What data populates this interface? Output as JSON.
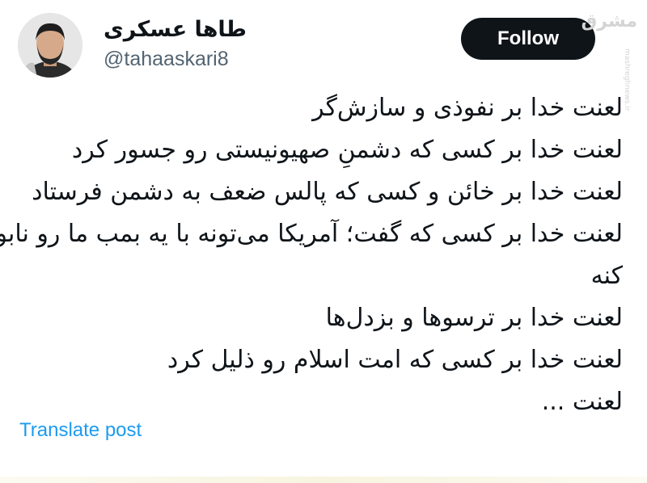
{
  "author": {
    "display_name": "طاها عسکری",
    "handle": "@tahaaskari8"
  },
  "actions": {
    "follow_label": "Follow",
    "translate_label": "Translate post"
  },
  "tweet": {
    "lines": [
      "لعنت خدا بر نفوذی و سازش‌گر",
      "لعنت خدا بر کسی که دشمنِ صهیونیستی رو جسور کرد",
      "لعنت خدا بر خائن و کسی که پالس ضعف به دشمن فرستاد",
      "لعنت خدا بر کسی که گفت؛ آمریکا می‌تونه با یه بمب ما رو نابود",
      "کنه",
      "لعنت خدا بر ترسوها و بزدل‌ها",
      "لعنت خدا بر کسی که امت اسلام رو ذلیل کرد",
      "لعنت ..."
    ]
  },
  "watermark": {
    "logo_text": "مشرق",
    "url": "mashreghnews.ir"
  },
  "colors": {
    "follow_bg": "#0f1419",
    "link": "#1d9bf0",
    "handle": "#536471"
  }
}
